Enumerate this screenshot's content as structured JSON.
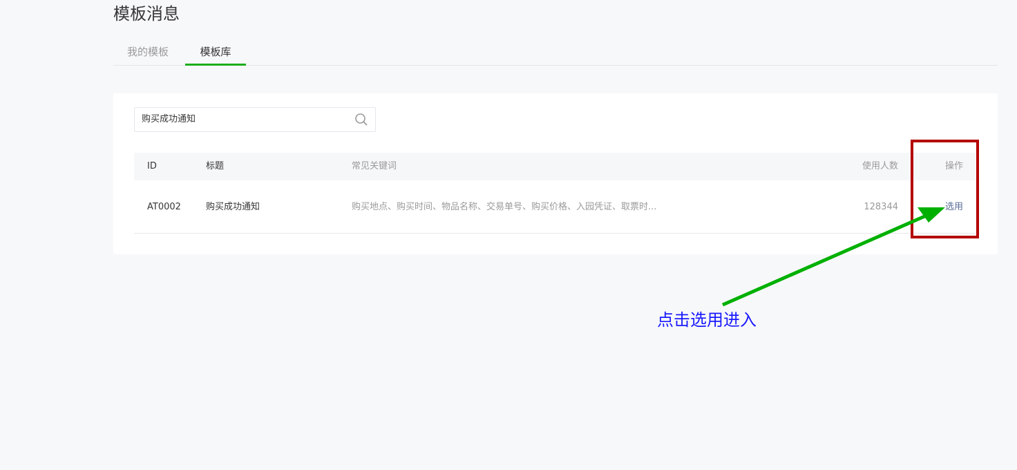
{
  "page_title": "模板消息",
  "tabs": [
    {
      "label": "我的模板",
      "active": false
    },
    {
      "label": "模板库",
      "active": true
    }
  ],
  "search": {
    "value": "购买成功通知",
    "icon": "search-icon"
  },
  "table": {
    "headers": {
      "id": "ID",
      "title": "标题",
      "keywords": "常见关键词",
      "usage": "使用人数",
      "action": "操作"
    },
    "rows": [
      {
        "id": "AT0002",
        "title": "购买成功通知",
        "keywords": "购买地点、购买时间、物品名称、交易单号、购买价格、入园凭证、取票时...",
        "usage": "128344",
        "action": "选用"
      }
    ]
  },
  "annotation": {
    "text": "点击选用进入",
    "arrow_color": "#00b000",
    "box_color": "#b40000"
  },
  "colors": {
    "accent": "#1aad19",
    "link": "#576b95"
  }
}
